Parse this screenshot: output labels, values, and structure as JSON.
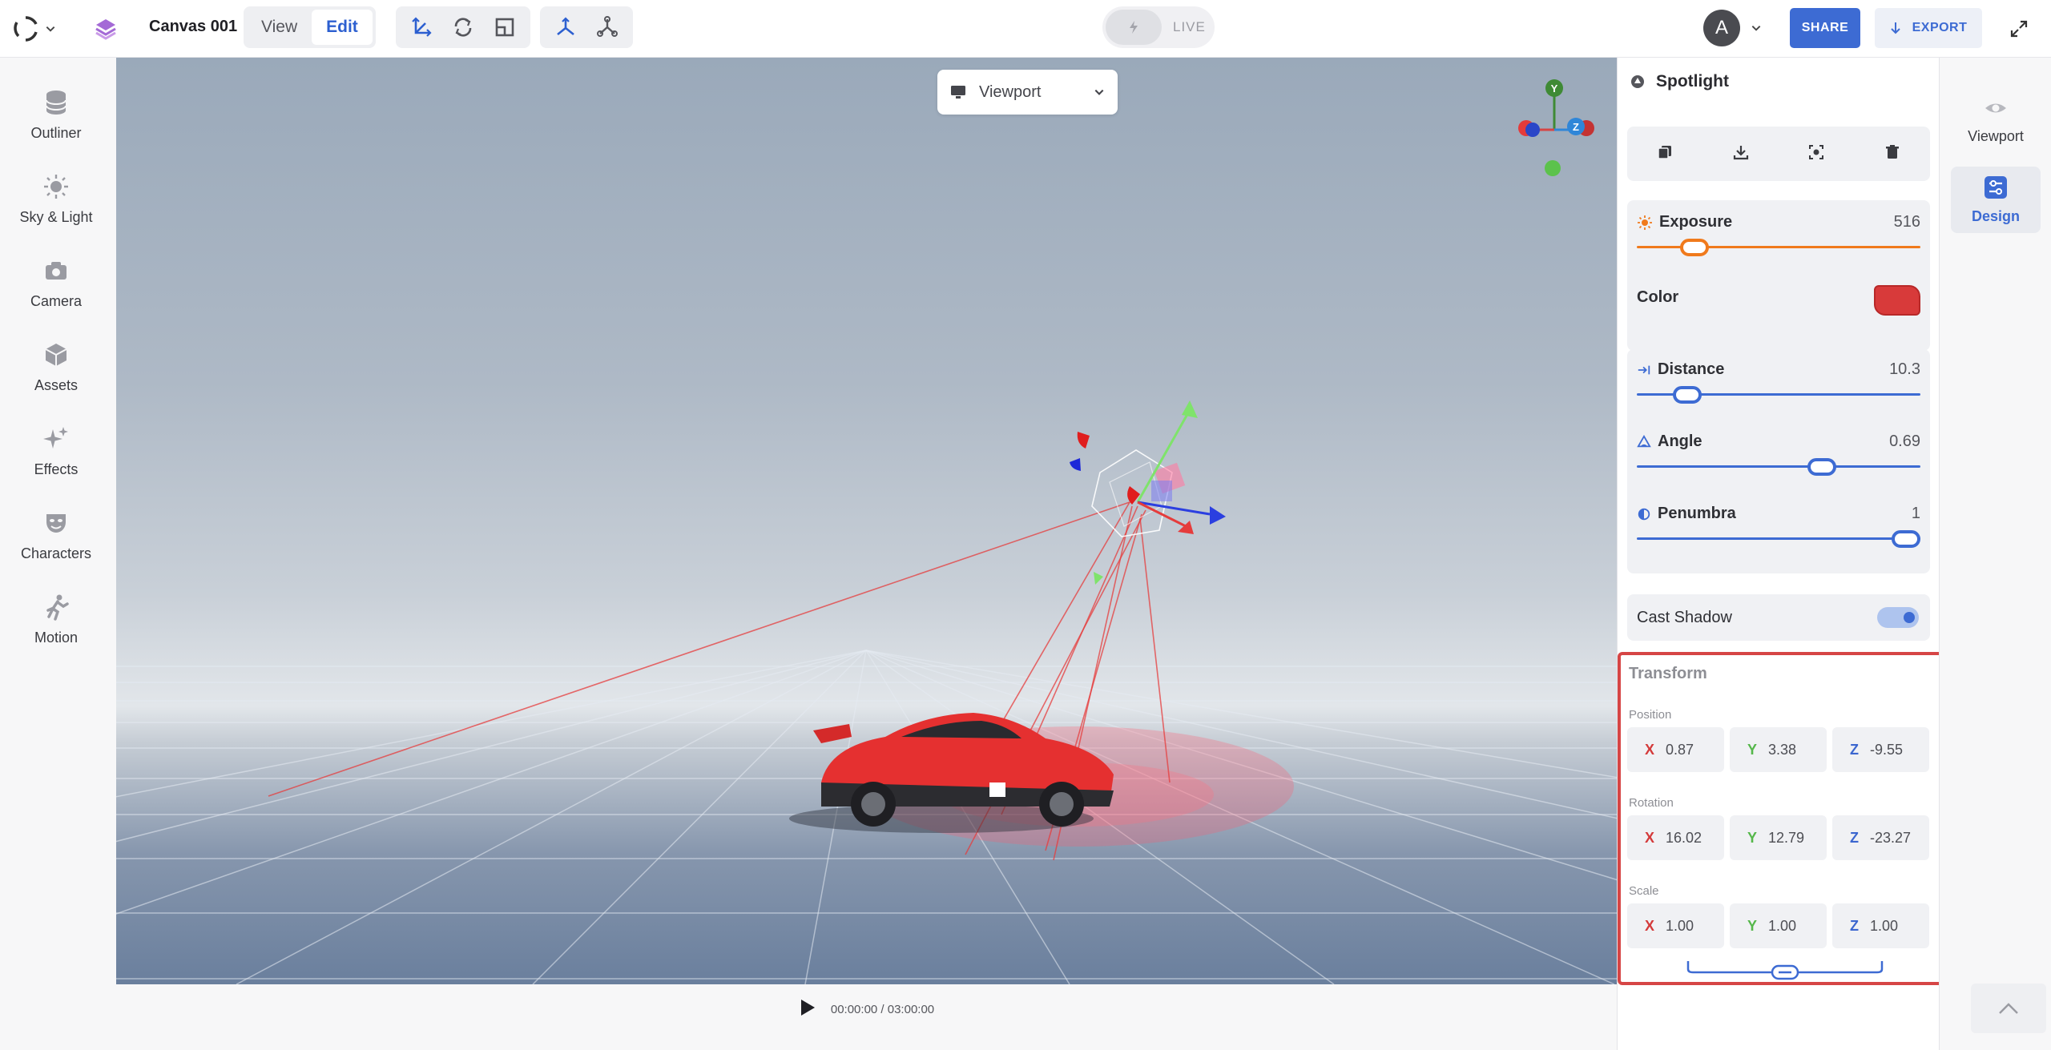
{
  "topbar": {
    "canvas_title": "Canvas 001",
    "mode_tabs": [
      {
        "label": "View",
        "active": false
      },
      {
        "label": "Edit",
        "active": true
      }
    ],
    "transform_tools": [
      "move-icon",
      "rotate-icon",
      "scale-icon"
    ],
    "snap_tools": [
      "axis-gizmo-icon",
      "node-graph-icon"
    ],
    "live_label": "LIVE",
    "avatar_initial": "A",
    "share_label": "SHARE",
    "export_label": "EXPORT"
  },
  "sidebar": {
    "items": [
      {
        "label": "Outliner",
        "icon": "database-icon"
      },
      {
        "label": "Sky & Light",
        "icon": "sun-icon"
      },
      {
        "label": "Camera",
        "icon": "camera-icon"
      },
      {
        "label": "Assets",
        "icon": "cube-icon"
      },
      {
        "label": "Effects",
        "icon": "sparkles-icon"
      },
      {
        "label": "Characters",
        "icon": "mask-icon"
      },
      {
        "label": "Motion",
        "icon": "running-icon"
      }
    ]
  },
  "viewport": {
    "camera_select": "Viewport"
  },
  "timeline": {
    "time": "00:00:00 / 03:00:00"
  },
  "panel": {
    "title": "Spotlight",
    "actions": [
      "duplicate-icon",
      "download-icon",
      "focus-icon",
      "trash-icon"
    ],
    "exposure": {
      "label": "Exposure",
      "value": "516",
      "fraction": 0.17
    },
    "color": {
      "label": "Color",
      "value": "#d83a3a"
    },
    "distance": {
      "label": "Distance",
      "value": "10.3",
      "fraction": 0.14
    },
    "angle": {
      "label": "Angle",
      "value": "0.69",
      "fraction": 0.67
    },
    "penumbra": {
      "label": "Penumbra",
      "value": "1",
      "fraction": 1.0
    },
    "cast_shadow": {
      "label": "Cast Shadow",
      "on": true
    },
    "transform": {
      "title": "Transform",
      "position": {
        "label": "Position",
        "x": "0.87",
        "y": "3.38",
        "z": "-9.55"
      },
      "rotation": {
        "label": "Rotation",
        "x": "16.02",
        "y": "12.79",
        "z": "-23.27"
      },
      "scale": {
        "label": "Scale",
        "x": "1.00",
        "y": "1.00",
        "z": "1.00"
      }
    }
  },
  "rail": {
    "items": [
      {
        "label": "Viewport",
        "icon": "eye-icon",
        "active": false
      },
      {
        "label": "Design",
        "icon": "sliders-icon",
        "active": true
      }
    ]
  },
  "colors": {
    "accent": "#3d6bd3",
    "exposure": "#f07a1c",
    "highlight": "#d64545"
  }
}
